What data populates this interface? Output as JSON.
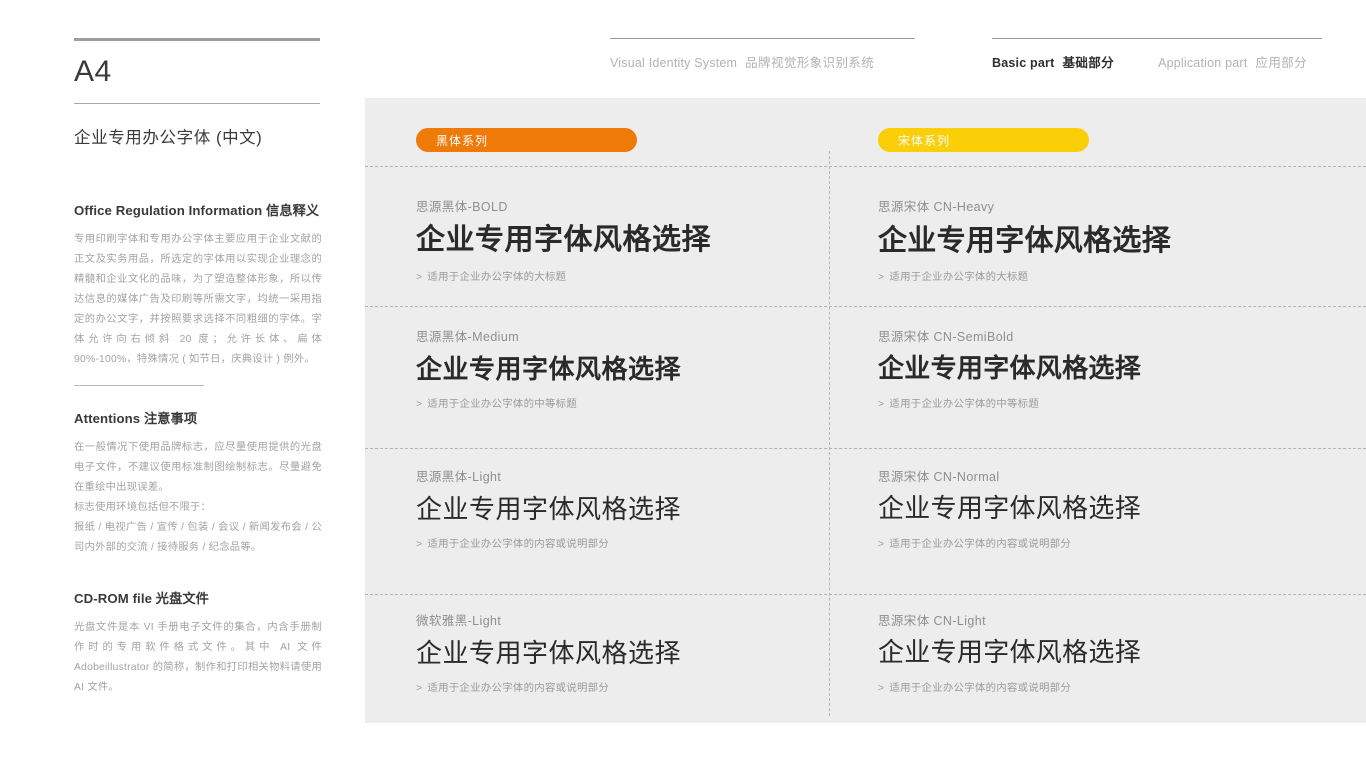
{
  "header": {
    "nav_left": [
      {
        "en": "Visual Identity System",
        "cn": "品牌视觉形象识别系统",
        "active": false
      },
      {
        "en": "",
        "cn": "",
        "active": false
      }
    ],
    "nav_right": [
      {
        "en": "Basic part",
        "cn": "基础部分",
        "active": true
      },
      {
        "en": "Application part",
        "cn": "应用部分",
        "active": false
      }
    ]
  },
  "sidebar": {
    "page_code": "A4",
    "page_title": "企业专用办公字体 (中文)",
    "sections": [
      {
        "heading_en": "Office Regulation Information",
        "heading_cn": "信息释义",
        "body": [
          "专用印刷字体和专用办公字体主要应用于企业文献的正文及实务用品，所选定的字体用以实现企业理念的精髓和企业文化的品味，为了塑造整体形象，所以传达信息的媒体广告及印刷等所需文字，均统一采用指定的办公文字，并按照要求选择不同粗细的字体。字体允许向右倾斜 20 度；允许长体、扁体 90%-100%，特殊情况 ( 如节日，庆典设计 ) 例外。"
        ]
      },
      {
        "heading_en": "Attentions",
        "heading_cn": "注意事项",
        "body": [
          "在一般情况下使用品牌标志，应尽量使用提供的光盘电子文件，不建议使用标准制图绘制标志。尽量避免在重绘中出现误差。",
          "标志使用环境包括但不限于：",
          "报纸 / 电视广告 / 宣传 / 包装 / 会议 / 新闻发布会 / 公司内外部的交流 / 接待服务 / 纪念品等。"
        ]
      },
      {
        "heading_en": "CD-ROM file",
        "heading_cn": "光盘文件",
        "body": [
          "光盘文件是本 VI 手册电子文件的集合，内含手册制作时的专用软件格式文件。其中 AI 文件 Adobeillustrator 的简称，制作和打印相关物料请使用 AI 文件。"
        ]
      }
    ]
  },
  "panel": {
    "background": "#ededed",
    "pills": [
      {
        "label": "黑体系列",
        "color": "#ef7a08"
      },
      {
        "label": "宋体系列",
        "color": "#fbcf08"
      }
    ],
    "left_column": [
      {
        "font_name": "思源黑体-BOLD",
        "sample": "企业专用字体风格选择",
        "caption": "适用于企业办公字体的大标题",
        "chevron": ">"
      },
      {
        "font_name": "思源黑体-Medium",
        "sample": "企业专用字体风格选择",
        "caption": "适用于企业办公字体的中等标题",
        "chevron": ">"
      },
      {
        "font_name": "思源黑体-Light",
        "sample": "企业专用字体风格选择",
        "caption": "适用于企业办公字体的内容或说明部分",
        "chevron": ">"
      },
      {
        "font_name": "微软雅黑-Light",
        "sample": "企业专用字体风格选择",
        "caption": "适用于企业办公字体的内容或说明部分",
        "chevron": ">"
      }
    ],
    "right_column": [
      {
        "font_name": "思源宋体 CN-Heavy",
        "sample": "企业专用字体风格选择",
        "caption": "适用于企业办公字体的大标题",
        "chevron": ">"
      },
      {
        "font_name": "思源宋体 CN-SemiBold",
        "sample": "企业专用字体风格选择",
        "caption": "适用于企业办公字体的中等标题",
        "chevron": ">"
      },
      {
        "font_name": "思源宋体 CN-Normal",
        "sample": "企业专用字体风格选择",
        "caption": "适用于企业办公字体的内容或说明部分",
        "chevron": ">"
      },
      {
        "font_name": "思源宋体 CN-Light",
        "sample": "企业专用字体风格选择",
        "caption": "适用于企业办公字体的内容或说明部分",
        "chevron": ">"
      }
    ]
  }
}
